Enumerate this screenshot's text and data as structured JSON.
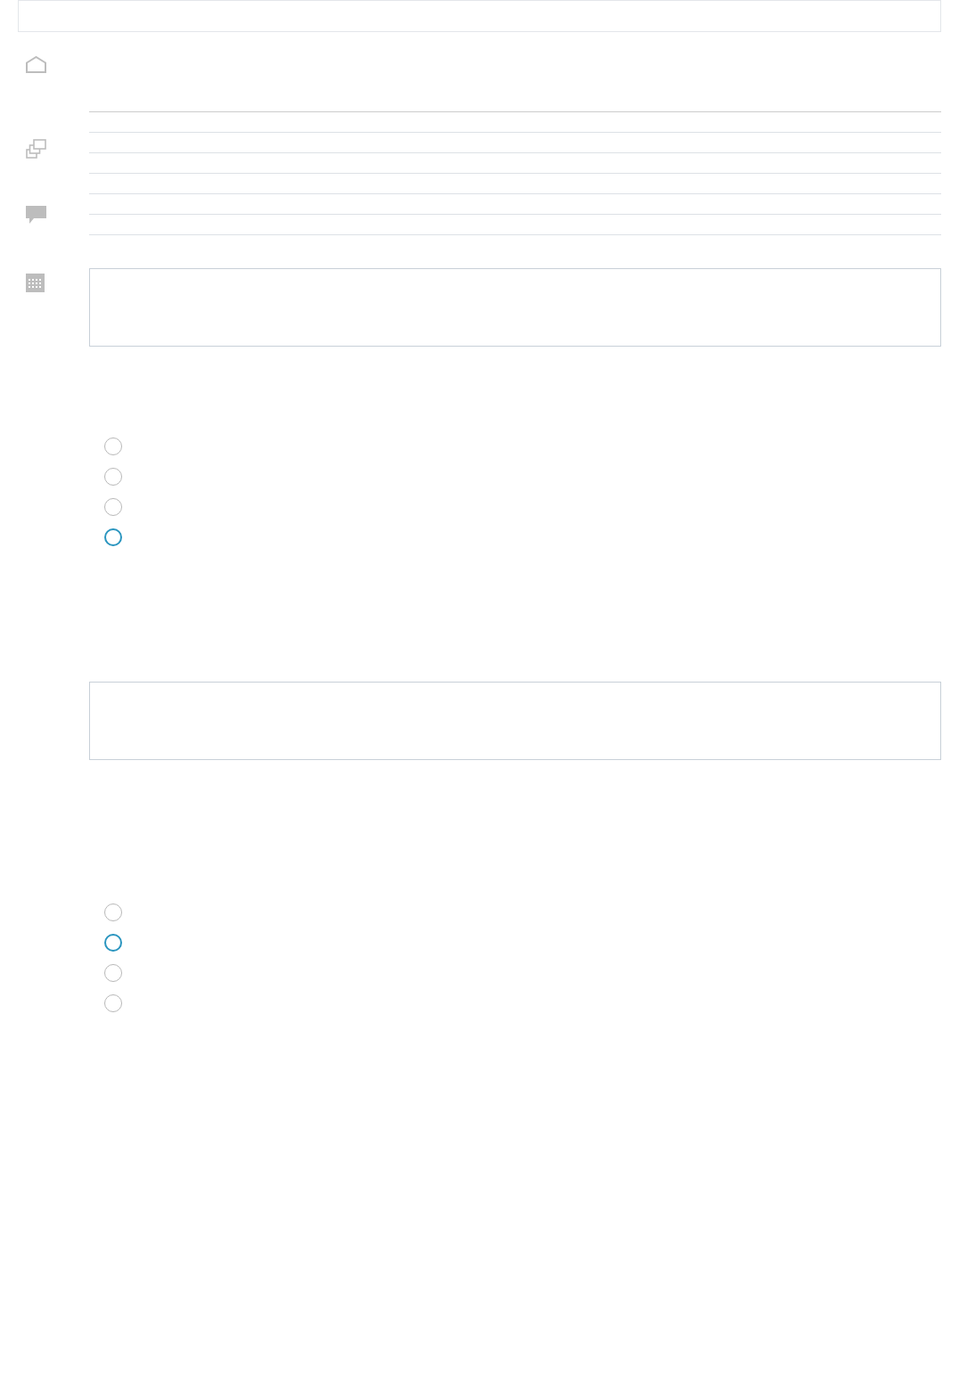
{
  "questions": [
    {
      "options": [
        {
          "color": "#b8b8b8"
        },
        {
          "color": "#b8b8b8"
        },
        {
          "color": "#b8b8b8"
        },
        {
          "color": "#2a95bf"
        }
      ]
    },
    {
      "options": [
        {
          "color": "#b8b8b8"
        },
        {
          "color": "#2a95bf"
        },
        {
          "color": "#b8b8b8"
        },
        {
          "color": "#b8b8b8"
        }
      ]
    }
  ]
}
